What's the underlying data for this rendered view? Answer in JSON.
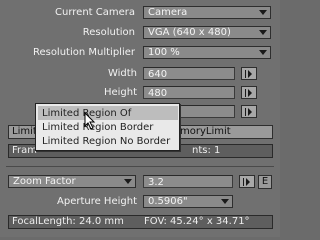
{
  "camera": {
    "current_camera_label": "Current Camera",
    "current_camera_value": "Camera",
    "resolution_label": "Resolution",
    "resolution_value": "VGA (640 x 480)",
    "multiplier_label": "Resolution Multiplier",
    "multiplier_value": "100 %",
    "width_label": "Width",
    "width_value": "640",
    "height_label": "Height",
    "height_value": "480"
  },
  "limited_region_button": "Limited Region Of",
  "memory_limit_button": "ntl MemoryLimit",
  "frame_aspect_partial": "Fram",
  "segments_partial": "nts: 1",
  "menu": {
    "items": [
      "Limited Region Of",
      "Limited Region Border",
      "Limited Region No Border"
    ]
  },
  "zoom": {
    "dropdown_value": "Zoom Factor",
    "zoom_value": "3.2",
    "aperture_label": "Aperture Height",
    "aperture_value": "0.5906\"",
    "e_button": "E"
  },
  "status": {
    "focal_length": "FocalLength: 24.0 mm",
    "fov": "FOV: 45.24° x 34.71°"
  }
}
